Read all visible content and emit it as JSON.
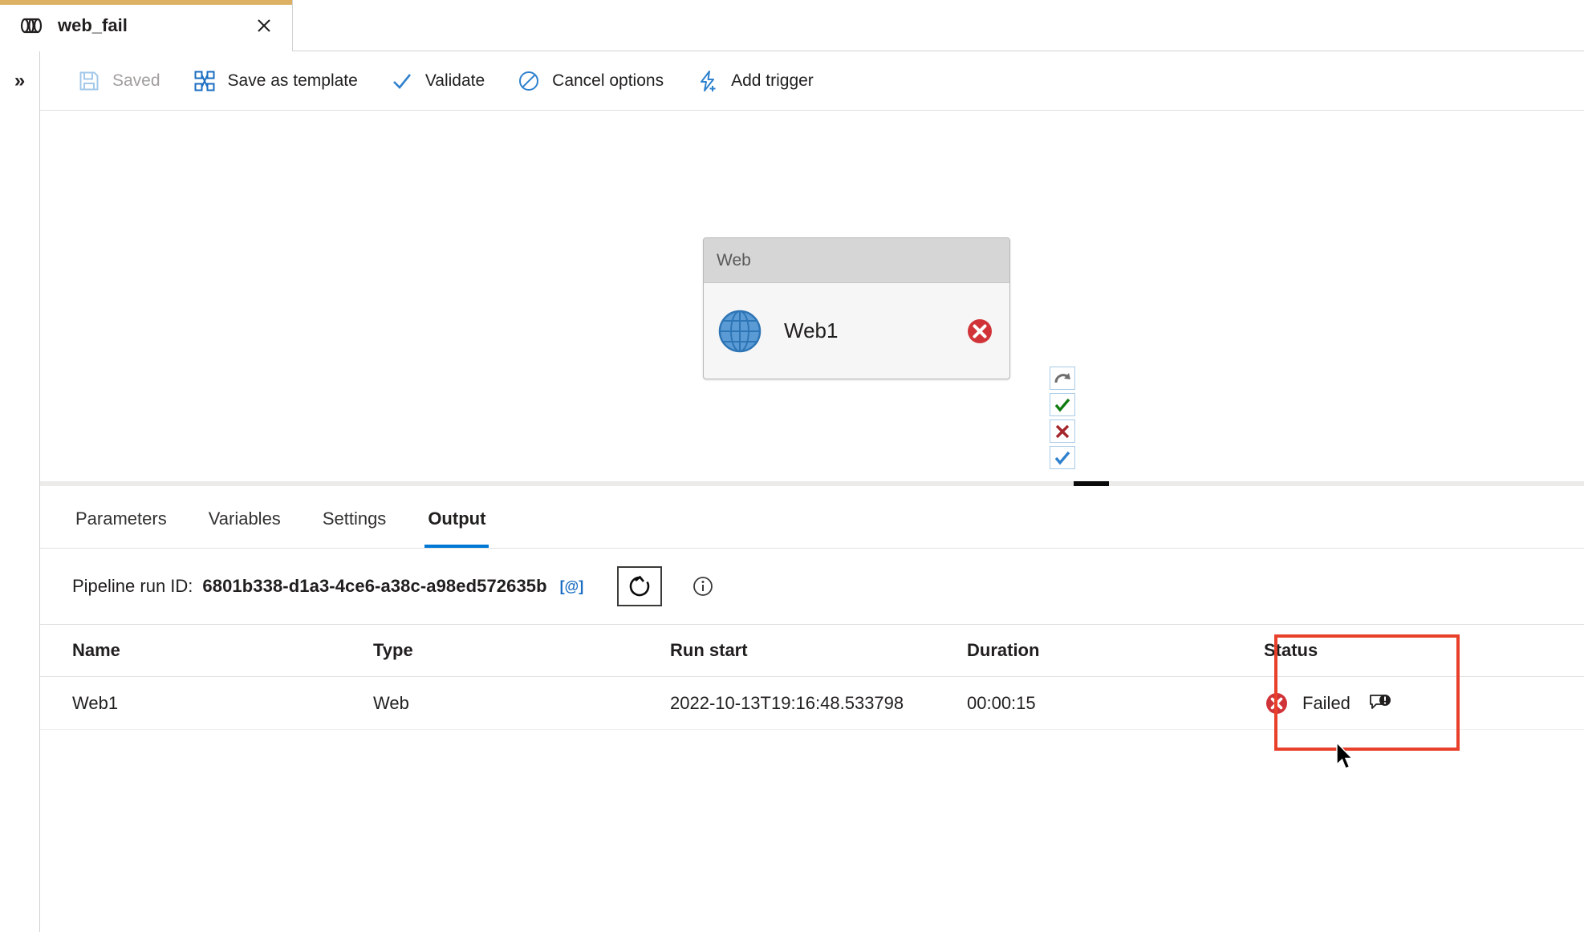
{
  "accent": {
    "tab_stripe": "#dcb163",
    "active_tab_underline": "#0078d4",
    "highlight_box": "#e8402a",
    "failed_red": "#d13438",
    "success_green": "#107c10",
    "link_blue": "#1b6ec2"
  },
  "tab": {
    "title": "web_fail",
    "icon": "pipeline-icon",
    "close_icon": "close-icon"
  },
  "left_rail": {
    "expand_label": "»",
    "expand_icon": "chevron-double-right-icon"
  },
  "toolbar": {
    "items": [
      {
        "label": "Saved",
        "icon": "save-icon",
        "disabled": true
      },
      {
        "label": "Save as template",
        "icon": "save-template-icon",
        "disabled": false
      },
      {
        "label": "Validate",
        "icon": "checkmark-icon",
        "disabled": false
      },
      {
        "label": "Cancel options",
        "icon": "cancel-circle-icon",
        "disabled": false
      },
      {
        "label": "Add trigger",
        "icon": "lightning-plus-icon",
        "disabled": false
      }
    ]
  },
  "canvas": {
    "node": {
      "type": "Web",
      "name": "Web1",
      "activity_icon": "globe-icon",
      "status_icon": "error-circle-icon"
    },
    "handles": [
      {
        "name": "skip-handle",
        "icon": "skip-arrow-icon"
      },
      {
        "name": "success-handle",
        "icon": "check-green-icon"
      },
      {
        "name": "failure-handle",
        "icon": "x-red-icon"
      },
      {
        "name": "completion-handle",
        "icon": "check-blue-icon"
      }
    ],
    "splitter_icon": "splitter-grip"
  },
  "panel": {
    "tabs": [
      {
        "label": "Parameters",
        "active": false
      },
      {
        "label": "Variables",
        "active": false
      },
      {
        "label": "Settings",
        "active": false
      },
      {
        "label": "Output",
        "active": true
      }
    ],
    "run_id": {
      "label": "Pipeline run ID:",
      "value": "6801b338-d1a3-4ce6-a38c-a98ed572635b",
      "copy_label": "[@]",
      "copy_icon": "copy-icon",
      "refresh_icon": "refresh-icon",
      "info_icon": "info-circle-icon"
    },
    "table": {
      "columns": [
        "Name",
        "Type",
        "Run start",
        "Duration",
        "Status"
      ],
      "rows": [
        {
          "name": "Web1",
          "type": "Web",
          "run_start": "2022-10-13T19:16:48.533798",
          "duration": "00:00:15",
          "status": "Failed",
          "status_icon": "error-circle-icon",
          "note_icon": "error-details-icon"
        }
      ]
    }
  }
}
